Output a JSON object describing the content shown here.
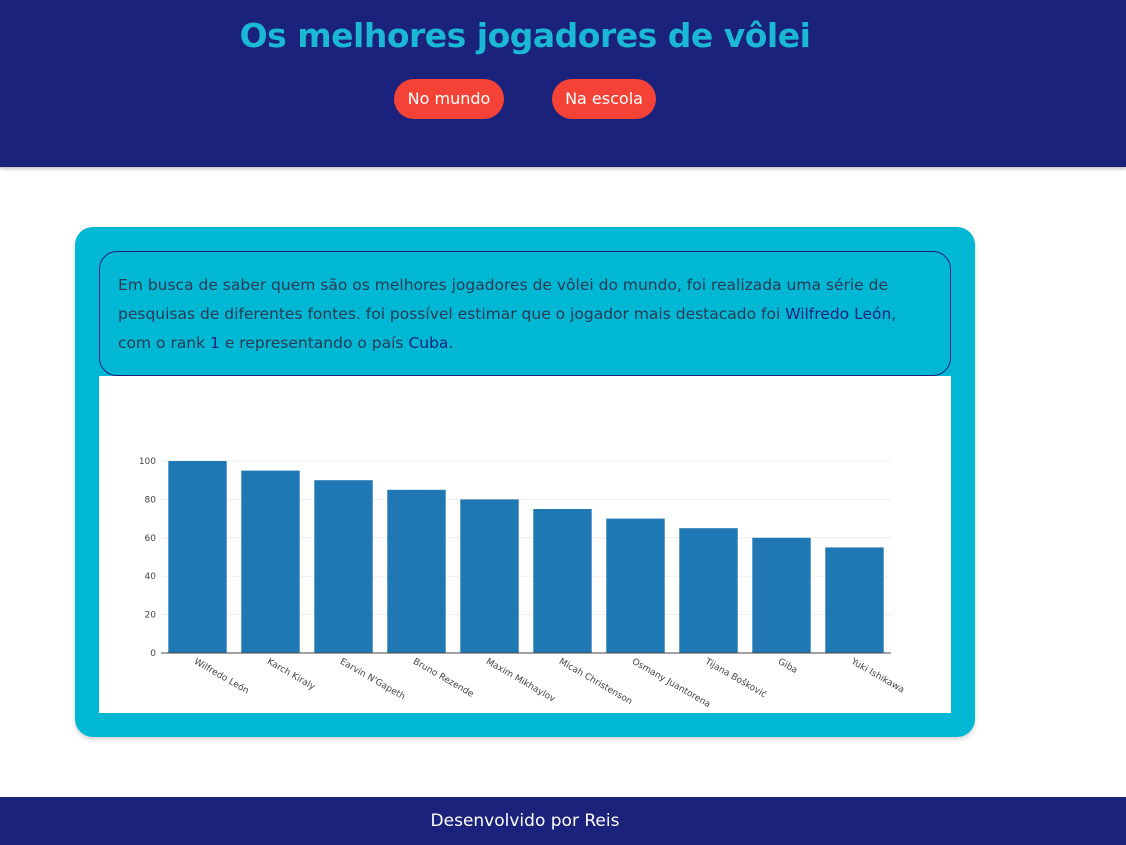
{
  "header": {
    "title": "Os melhores jogadores de vôlei",
    "nav": [
      {
        "label": "No mundo"
      },
      {
        "label": "Na escola"
      }
    ]
  },
  "info": {
    "text_before_name": "Em busca de saber quem são os melhores jogadores de vôlei do mundo, foi realizada uma série de pesquisas de diferentes fontes. foi possível estimar que o jogador mais destacado foi ",
    "top_player": "Wilfredo León",
    "text_before_rank": ", com o rank ",
    "rank": "1",
    "text_before_country": " e representando o país ",
    "country": "Cuba",
    "text_end": "."
  },
  "chart_data": {
    "type": "bar",
    "categories": [
      "Wilfredo León",
      "Karch Kiraly",
      "Earvin N'Gapeth",
      "Bruno Rezende",
      "Maxim Mikhaylov",
      "Micah Christenson",
      "Osmany Juantorena",
      "Tijana Bošković",
      "Giba",
      "Yuki Ishikawa"
    ],
    "values": [
      100,
      95,
      90,
      85,
      80,
      75,
      70,
      65,
      60,
      55
    ],
    "ylim": [
      0,
      100
    ],
    "yticks": [
      0,
      20,
      40,
      60,
      80,
      100
    ],
    "grid": true,
    "bar_color": "#1f77b4"
  },
  "footer": {
    "text": "Desenvolvido por Reis"
  },
  "colors": {
    "header_bg": "#1b227c",
    "title": "#1ab8d4",
    "button_bg": "#f44336",
    "card_bg": "#00b8d4",
    "highlight": "#1b227c"
  }
}
